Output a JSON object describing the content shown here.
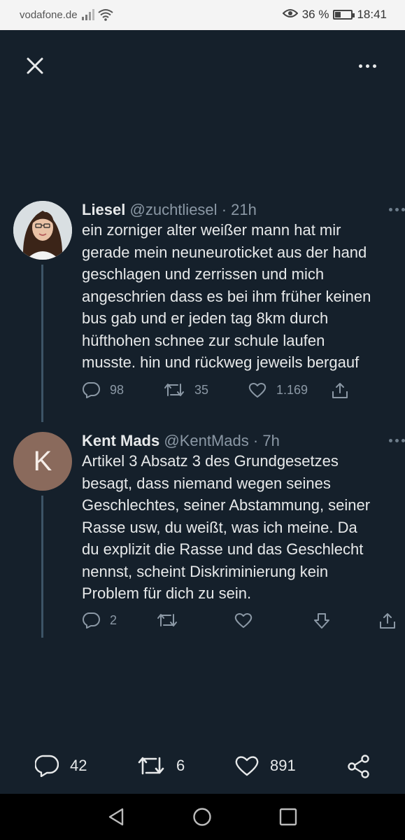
{
  "status_bar": {
    "carrier": "vodafone.de",
    "battery_text": "36 %",
    "battery_level": 0.36,
    "time": "18:41"
  },
  "icons": {
    "close": "close-icon",
    "more": "more-horizontal-icon",
    "reply": "reply-icon",
    "retweet": "retweet-icon",
    "like": "heart-icon",
    "share": "share-icon",
    "downvote": "downvote-icon",
    "share_network": "share-network-icon"
  },
  "tweets": [
    {
      "name": "Liesel",
      "handle": "@zuchtliesel",
      "time": "· 21h",
      "text": "ein zorniger alter weißer mann hat mir\ngerade mein neuneuroticket aus der hand\ngeschlagen und zerrissen und mich\nangeschrien dass es bei ihm früher keinen\nbus gab und er jeden tag 8km durch\nhüfthohen schnee zur schule laufen\nmusste. hin und rückweg jeweils bergauf",
      "replies": "98",
      "retweets": "35",
      "likes": "1.169"
    },
    {
      "name": "Kent Mads",
      "handle": "@KentMads",
      "time": "· 7h",
      "avatar_letter": "K",
      "text": "Artikel 3 Absatz 3 des Grundgesetzes\nbesagt, dass niemand wegen seines\nGeschlechtes, seiner Abstammung, seiner\nRasse usw, du weißt, was ich meine. Da\ndu explizit die Rasse und das Geschlecht\nnennst, scheint Diskriminierung kein\nProblem für dich zu sein.",
      "replies": "2"
    }
  ],
  "bottom_bar": {
    "replies": "42",
    "retweets": "6",
    "likes": "891"
  },
  "colors": {
    "background": "#15202b",
    "muted": "#8b98a5",
    "kent_avatar": "#8a6a5c"
  }
}
